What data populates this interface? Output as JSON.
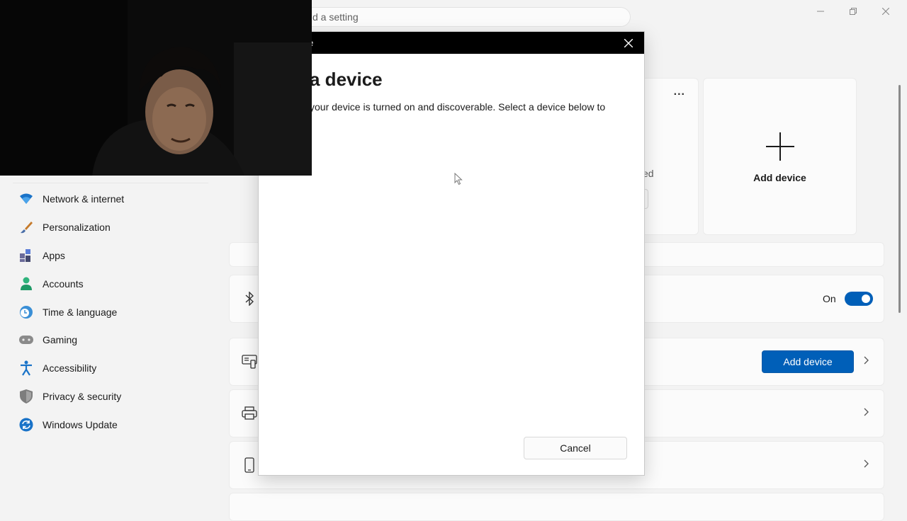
{
  "search": {
    "placeholder_text": "d a setting"
  },
  "sidebar": {
    "items": [
      {
        "label": "Network & internet",
        "icon": "wifi-icon"
      },
      {
        "label": "Personalization",
        "icon": "brush-icon"
      },
      {
        "label": "Apps",
        "icon": "apps-icon"
      },
      {
        "label": "Accounts",
        "icon": "person-icon"
      },
      {
        "label": "Time & language",
        "icon": "globe-clock-icon"
      },
      {
        "label": "Gaming",
        "icon": "gamepad-icon"
      },
      {
        "label": "Accessibility",
        "icon": "accessibility-icon"
      },
      {
        "label": "Privacy & security",
        "icon": "shield-icon"
      },
      {
        "label": "Windows Update",
        "icon": "update-icon"
      }
    ]
  },
  "devices": {
    "more_label": "...",
    "partial_status": "ed",
    "add_device_tile_label": "Add device"
  },
  "bluetooth": {
    "state_label": "On",
    "toggle_on": true
  },
  "add_device_row": {
    "button_label": "Add device"
  },
  "dialog": {
    "title_partial": "e",
    "heading": "a device",
    "description": "your device is turned on and discoverable. Select a device below to",
    "cancel_label": "Cancel"
  },
  "colors": {
    "accent": "#005fb8",
    "dialog_titlebar": "#000000",
    "background": "#f3f3f3"
  }
}
